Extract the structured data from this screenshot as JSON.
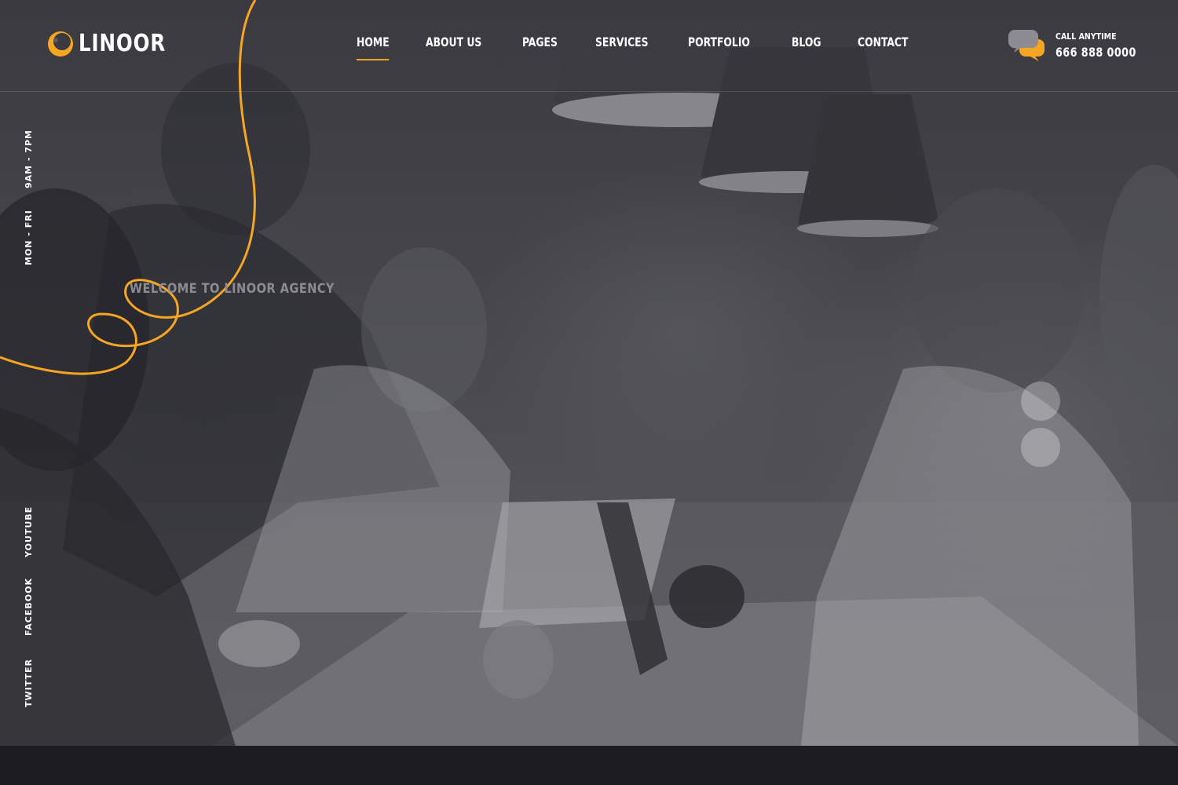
{
  "brand": {
    "name": "LINOOR",
    "accent_color": "#f6a623",
    "logo_icon": "crescent-logo-icon"
  },
  "nav": {
    "items": [
      {
        "label": "Home",
        "active": true
      },
      {
        "label": "About Us",
        "active": false
      },
      {
        "label": "Pages",
        "active": false
      },
      {
        "label": "Services",
        "active": false
      },
      {
        "label": "Portfolio",
        "active": false
      },
      {
        "label": "Blog",
        "active": false
      },
      {
        "label": "Contact",
        "active": false
      }
    ]
  },
  "contact": {
    "icon": "chat-bubbles-icon",
    "label": "Call Anytime",
    "phone": "666 888 0000"
  },
  "hours": {
    "days": "Mon - Fri",
    "time": "9am - 7pm"
  },
  "social": {
    "items": [
      "Youtube",
      "Facebook",
      "Twitter"
    ]
  },
  "hero": {
    "welcome": "Welcome to Linoor Agency",
    "slide_count": 2
  }
}
